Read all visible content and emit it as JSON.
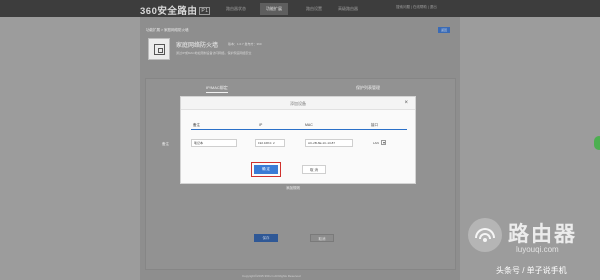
{
  "topbar": {
    "logo": "360安全路由",
    "logo_badge": "P1",
    "tabs": [
      "路由器状态",
      "功能扩展",
      "路由设置",
      "高级路由器"
    ],
    "active_tab_index": 1,
    "right_links": "搜索问题 | 在线帮助 | 退出"
  },
  "breadcrumb": "功能扩展 > 家庭网络防火墙",
  "back_button": "返回",
  "app": {
    "icon": "firewall-app-icon",
    "title": "家庭网络防火墙",
    "meta": "版本：1.0.7  发布方：360",
    "description": "通过IP或MAC地址限制设备访问网络，保护家庭网络安全"
  },
  "subtabs": [
    "IP/MAC绑定",
    "保护列表管理"
  ],
  "background": {
    "label": "备注",
    "link": "添加规则",
    "save_button": "保存",
    "cancel_button": "取消"
  },
  "footer": "Copyright©2015 360.cn All Rights Reserved",
  "modal": {
    "title": "添加设备",
    "close": "×",
    "columns": [
      "备注",
      "IP",
      "MAC",
      "接口"
    ],
    "row": {
      "name": "笔记本",
      "ip": "192.168.0. 2",
      "mac": "AC-2B-6E-1C-13-87",
      "interface": "LAN"
    },
    "confirm": "确 定",
    "cancel": "取 消",
    "accent": "#3a7bd5",
    "highlight": "#d0312d"
  },
  "watermark": {
    "name": "路由器",
    "url": "luyouqi.com",
    "tag": "头条号 / 单子说手机"
  }
}
